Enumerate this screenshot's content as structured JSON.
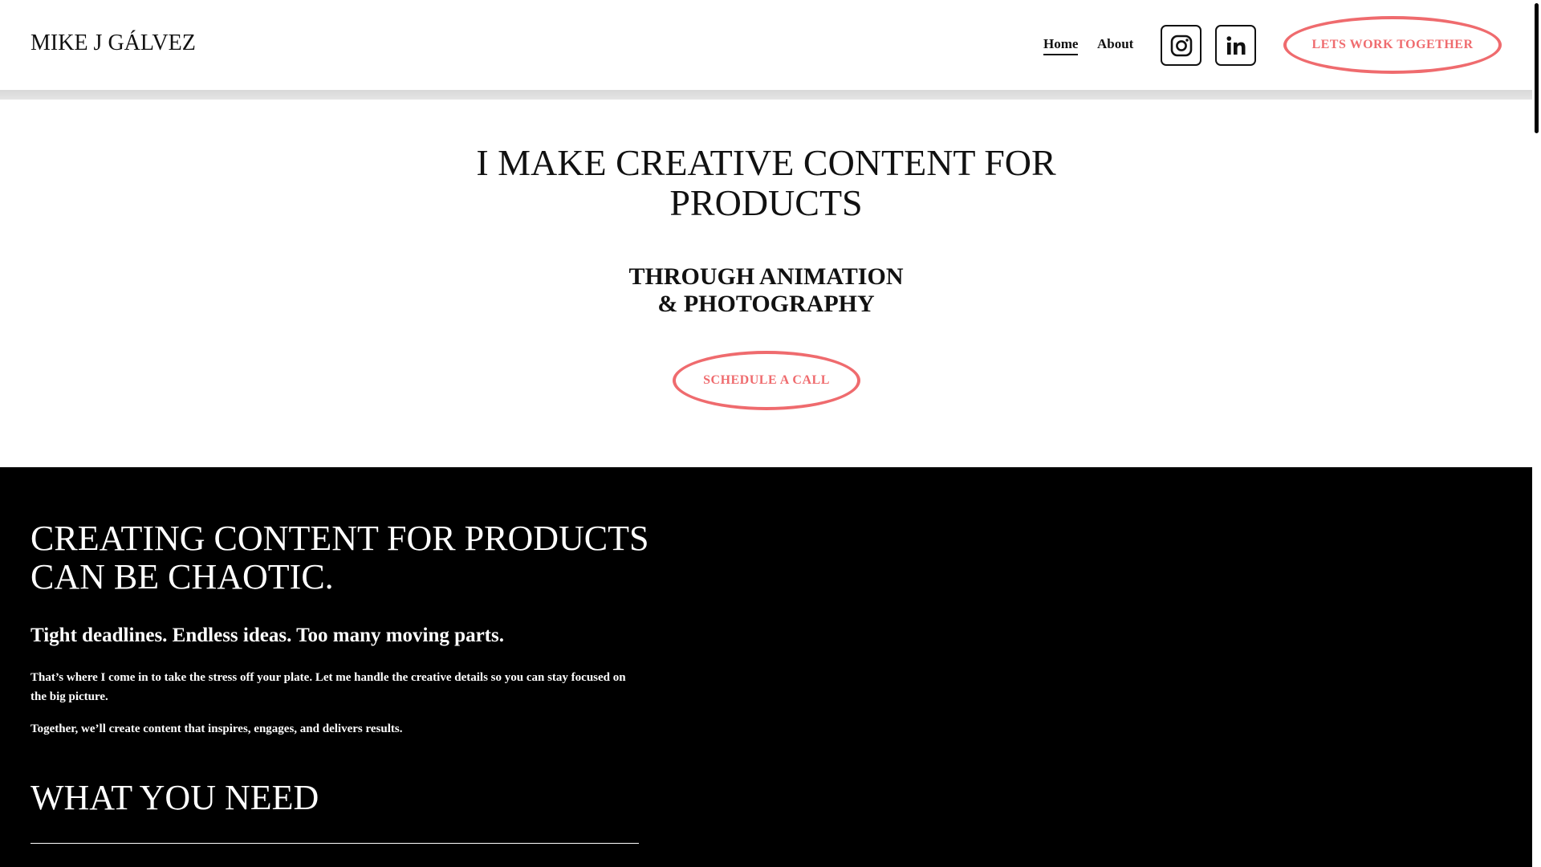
{
  "header": {
    "brand": "MIKE J GÁLVEZ",
    "nav": [
      {
        "label": "Home",
        "active": true
      },
      {
        "label": "About",
        "active": false
      }
    ],
    "social": [
      {
        "icon": "instagram-icon"
      },
      {
        "icon": "linkedin-icon"
      }
    ],
    "cta_label": "LETS WORK TOGETHER"
  },
  "hero": {
    "title_line1": "I MAKE CREATIVE CONTENT FOR",
    "title_line2": "PRODUCTS",
    "subtitle_line1": "THROUGH ANIMATION",
    "subtitle_line2": "& PHOTOGRAPHY",
    "cta_label": "SCHEDULE A CALL"
  },
  "section": {
    "title_line1": "CREATING CONTENT FOR PRODUCTS",
    "title_line2": "CAN BE CHAOTIC.",
    "lead": "Tight deadlines. Endless ideas. Too many moving parts.",
    "paragraph1": "That’s where I come in to take the stress off your plate. Let me handle the creative details so you can stay focused on the big picture.",
    "paragraph2": "Together, we’ll create content that inspires, engages, and delivers results.",
    "heading2": "WHAT YOU NEED"
  },
  "colors": {
    "accent": "#ef6b6e",
    "dark_bg": "#000000",
    "text": "#111111"
  }
}
